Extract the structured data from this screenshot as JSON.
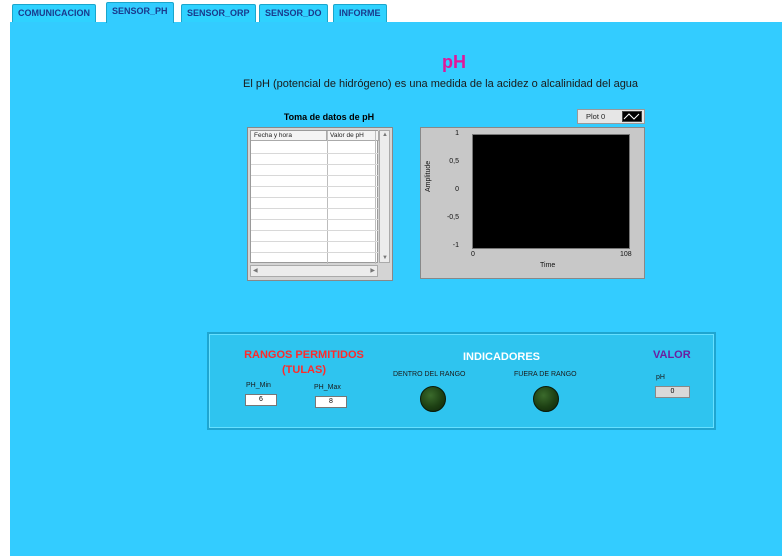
{
  "tabs": [
    {
      "label": "COMUNICACION",
      "active": false
    },
    {
      "label": "SENSOR_PH",
      "active": true
    },
    {
      "label": "SENSOR_ORP",
      "active": false
    },
    {
      "label": "SENSOR_DO",
      "active": false
    },
    {
      "label": "INFORME",
      "active": false
    }
  ],
  "page": {
    "title": "pH",
    "subtitle": "El pH (potencial de hidrógeno) es una medida de la acidez o alcalinidad del agua"
  },
  "table": {
    "title": "Toma de datos de pH",
    "columns": [
      "Fecha y hora",
      "Valor de pH"
    ]
  },
  "graph": {
    "legend_label": "Plot 0",
    "ylabel": "Amplitude",
    "xlabel": "Time",
    "yticks": [
      "1",
      "0,5",
      "0",
      "-0,5",
      "-1"
    ],
    "xticks": [
      "0",
      "108"
    ]
  },
  "controls": {
    "rangos_line1": "RANGOS PERMITIDOS",
    "rangos_line2": "(TULAS)",
    "indicadores": "INDICADORES",
    "valor": "VALOR",
    "ph_min_label": "PH_Min",
    "ph_min_value": "6",
    "ph_max_label": "PH_Max",
    "ph_max_value": "8",
    "dentro_label": "DENTRO DEL RANGO",
    "fuera_label": "FUERA DE RANGO",
    "ph_label": "pH",
    "ph_value": "0"
  },
  "colors": {
    "panel_bg": "#33ccff",
    "title": "#e0179a",
    "rangos": "#ff2a2a",
    "valor": "#6a1fa0",
    "led_off": "#1d4013"
  }
}
